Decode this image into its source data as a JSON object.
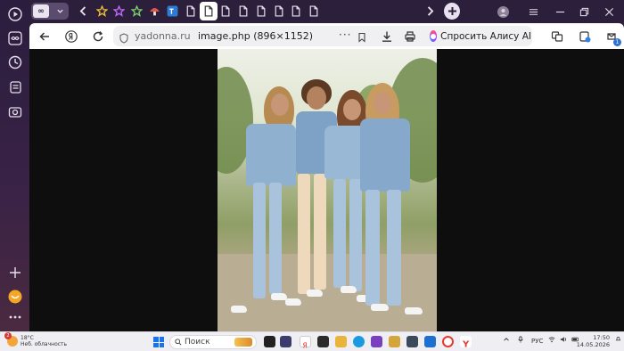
{
  "sidebar": {
    "items": [
      {
        "icon": "play-icon"
      },
      {
        "icon": "infinity-icon"
      },
      {
        "icon": "history-clock-icon"
      },
      {
        "icon": "collections-icon"
      },
      {
        "icon": "screenshot-icon"
      },
      {
        "icon": "add-icon"
      },
      {
        "icon": "zen-app-icon"
      },
      {
        "icon": "more-icon"
      }
    ]
  },
  "tabs": {
    "group_label": "∞",
    "items": [
      {
        "icon": "star-tab-icon",
        "color": "#f3c23a"
      },
      {
        "icon": "star-tab-icon",
        "color": "#c46cff"
      },
      {
        "icon": "star-tab-icon",
        "color": "#7dd36e"
      },
      {
        "icon": "mushroom-tab-icon",
        "color": "#e2574c"
      },
      {
        "icon": "tw-tab-icon",
        "color": "#2e7bd6"
      },
      {
        "icon": "document-tab-icon",
        "color": "#e8e2f0"
      },
      {
        "icon": "document-tab-icon",
        "color": "#333333",
        "active": true
      },
      {
        "icon": "document-tab-icon",
        "color": "#e8e2f0"
      },
      {
        "icon": "document-tab-icon",
        "color": "#e8e2f0"
      },
      {
        "icon": "document-tab-icon",
        "color": "#e8e2f0"
      },
      {
        "icon": "document-tab-icon",
        "color": "#e8e2f0"
      },
      {
        "icon": "document-tab-icon",
        "color": "#e8e2f0"
      },
      {
        "icon": "document-tab-icon",
        "color": "#e8e2f0"
      }
    ]
  },
  "toolbar": {
    "domain": "yadonna.ru",
    "page_title": "image.php (896×1152)",
    "more": "···",
    "alice_label": "Спросить Алису AI",
    "ext_badge": "1"
  },
  "weather": {
    "badge": "2",
    "temp": "18°C",
    "condition": "Неб. облачность"
  },
  "taskbar": {
    "search_placeholder": "Поиск",
    "lang": "РУС",
    "time": "17:50",
    "date": "14.05.2026"
  },
  "colors": {
    "sidebar_bg": "#2a1d3d",
    "toolbar_bg": "#ffffff",
    "content_bg": "#0e0e0e",
    "taskbar_bg": "#efeef2"
  }
}
